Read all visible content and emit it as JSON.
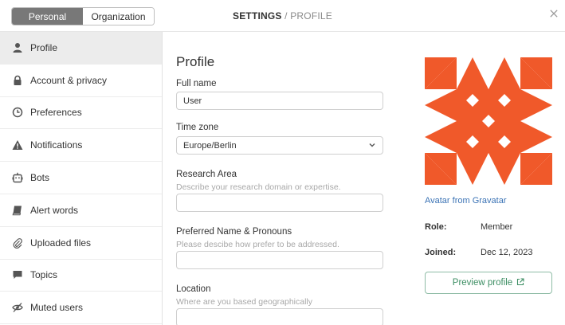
{
  "header": {
    "tabs": [
      {
        "label": "Personal",
        "active": true
      },
      {
        "label": "Organization",
        "active": false
      }
    ],
    "title_strong": "SETTINGS",
    "title_rest": " / PROFILE",
    "close_icon": "close-icon"
  },
  "sidebar": {
    "items": [
      {
        "label": "Profile",
        "icon": "user-icon",
        "active": true
      },
      {
        "label": "Account & privacy",
        "icon": "lock-icon"
      },
      {
        "label": "Preferences",
        "icon": "clock-icon"
      },
      {
        "label": "Notifications",
        "icon": "warning-icon"
      },
      {
        "label": "Bots",
        "icon": "bot-icon"
      },
      {
        "label": "Alert words",
        "icon": "book-icon"
      },
      {
        "label": "Uploaded files",
        "icon": "paperclip-icon"
      },
      {
        "label": "Topics",
        "icon": "comment-icon"
      },
      {
        "label": "Muted users",
        "icon": "eye-slash-icon"
      }
    ]
  },
  "profile": {
    "heading": "Profile",
    "full_name": {
      "label": "Full name",
      "value": "User"
    },
    "time_zone": {
      "label": "Time zone",
      "value": "Europe/Berlin"
    },
    "research_area": {
      "label": "Research Area",
      "hint": "Describe your research domain or expertise.",
      "value": ""
    },
    "pronouns": {
      "label": "Preferred Name & Pronouns",
      "hint": "Please descibe how prefer to be addressed.",
      "value": ""
    },
    "location": {
      "label": "Location",
      "hint": "Where are you based geographically",
      "value": ""
    }
  },
  "side_panel": {
    "gravatar_link": "Avatar from Gravatar",
    "role_label": "Role:",
    "role_value": "Member",
    "joined_label": "Joined:",
    "joined_value": "Dec 12, 2023",
    "preview_button": "Preview profile",
    "preview_icon": "external-link-icon"
  },
  "colors": {
    "avatar_orange": "#f0592a",
    "link_blue": "#3b73b5",
    "preview_green": "#3c8e63",
    "active_tab": "#787878"
  }
}
